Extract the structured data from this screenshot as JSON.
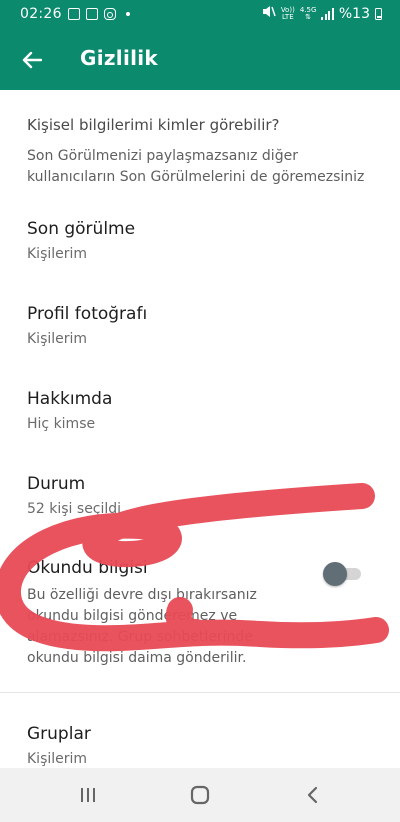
{
  "status_bar": {
    "time": "02:26",
    "net_label_top": "Vo))",
    "net_label_bottom": "LTE",
    "net_4g": "4.5G",
    "battery_text": "%13"
  },
  "app_bar": {
    "title": "Gizlilik",
    "back_icon": "arrow-left-icon"
  },
  "section": {
    "header": "Kişisel bilgilerimi kimler görebilir?",
    "description": "Son Görülmenizi paylaşmazsanız diğer kullanıcıların Son Görülmelerini de göremezsiniz"
  },
  "settings": [
    {
      "title": "Son görülme",
      "value": "Kişilerim"
    },
    {
      "title": "Profil fotoğrafı",
      "value": "Kişilerim"
    },
    {
      "title": "Hakkımda",
      "value": "Hiç kimse"
    },
    {
      "title": "Durum",
      "value": "52 kişi seçildi"
    }
  ],
  "read_receipts": {
    "title": "Okundu bilgisi",
    "desc_line1": "Bu özelliği devre dışı bırakırsanız",
    "desc_line2": "okundu bilgisi gönderemez ve",
    "desc_line3": "alamazsınız. Grup sohbetlerinde",
    "desc_line4": "okundu bilgisi daima gönderilir.",
    "enabled": false
  },
  "groups": {
    "title": "Gruplar",
    "value": "Kişilerim"
  },
  "colors": {
    "brand": "#0b8a6d",
    "annotation": "#e84a55",
    "toggle_thumb": "#616e75"
  },
  "nav_bar": {
    "recents_icon": "recent-apps-icon",
    "home_icon": "home-icon",
    "back_icon": "back-chevron-icon"
  }
}
